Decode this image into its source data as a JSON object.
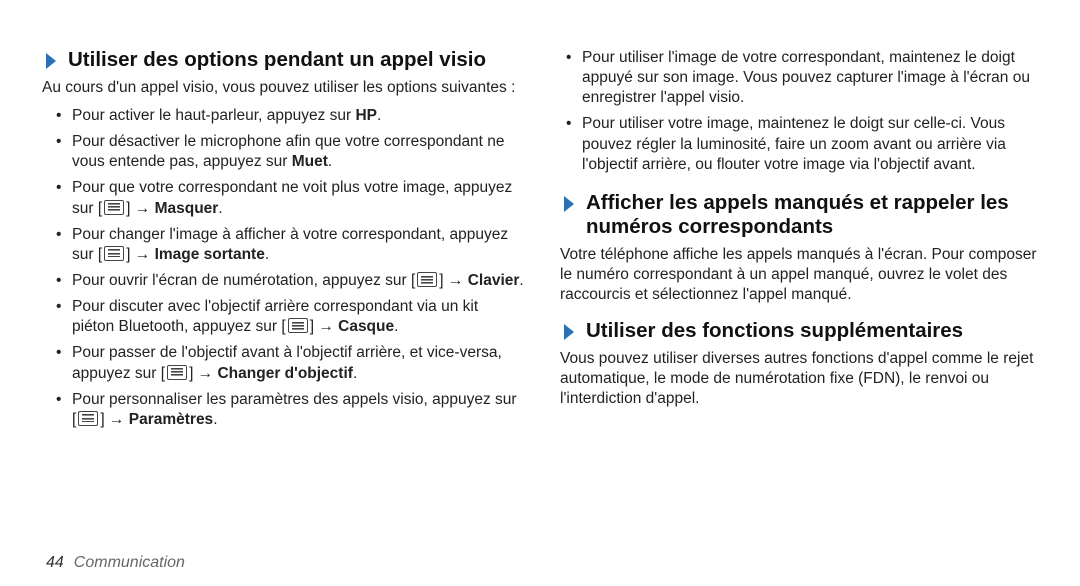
{
  "left": {
    "heading": "Utiliser des options pendant un appel visio",
    "intro": "Au cours d'un appel visio, vous pouvez utiliser les options suivantes :",
    "items": [
      {
        "pre": "Pour activer le haut-parleur, appuyez sur ",
        "bold": "HP",
        "post": "."
      },
      {
        "pre": "Pour désactiver le microphone afin que votre correspondant ne vous entende pas, appuyez sur ",
        "bold": "Muet",
        "post": "."
      },
      {
        "pre": "Pour que votre correspondant ne voit plus votre image, appuyez sur [",
        "icon": true,
        "mid": "] → ",
        "bold": "Masquer",
        "post": "."
      },
      {
        "pre": "Pour changer l'image à afficher à votre correspondant, appuyez sur [",
        "icon": true,
        "mid": "] → ",
        "bold": "Image sortante",
        "post": "."
      },
      {
        "pre": "Pour ouvrir l'écran de numérotation, appuyez sur [",
        "icon": true,
        "mid": "] → ",
        "bold": "Clavier",
        "post": "."
      },
      {
        "pre": "Pour discuter avec l'objectif arrière correspondant via un kit piéton Bluetooth, appuyez sur [",
        "icon": true,
        "mid": "] → ",
        "bold": "Casque",
        "post": "."
      },
      {
        "pre": "Pour passer de l'objectif avant à l'objectif arrière, et vice-versa, appuyez sur [",
        "icon": true,
        "mid": "] → ",
        "bold": "Changer d'objectif",
        "post": "."
      },
      {
        "pre": "Pour personnaliser les paramètres des appels visio, appuyez sur [",
        "icon": true,
        "mid": "] → ",
        "bold": "Paramètres",
        "post": "."
      }
    ]
  },
  "right": {
    "top_items": [
      {
        "text": "Pour utiliser l'image de votre correspondant, maintenez le doigt appuyé sur son image. Vous pouvez capturer l'image à l'écran ou enregistrer l'appel visio."
      },
      {
        "text": "Pour utiliser votre image, maintenez le doigt sur celle-ci. Vous pouvez régler la luminosité, faire un zoom avant ou arrière via l'objectif arrière, ou flouter votre image via l'objectif avant."
      }
    ],
    "heading2": "Afficher les appels manqués et rappeler les numéros correspondants",
    "para2": "Votre téléphone affiche les appels manqués à l'écran. Pour composer le numéro correspondant à un appel manqué, ouvrez le volet des raccourcis et sélectionnez l'appel manqué.",
    "heading3": "Utiliser des fonctions supplémentaires",
    "para3": "Vous pouvez utiliser diverses autres fonctions d'appel comme le rejet automatique, le mode de numérotation fixe (FDN), le renvoi ou l'interdiction d'appel."
  },
  "footer": {
    "page": "44",
    "section": "Communication"
  }
}
